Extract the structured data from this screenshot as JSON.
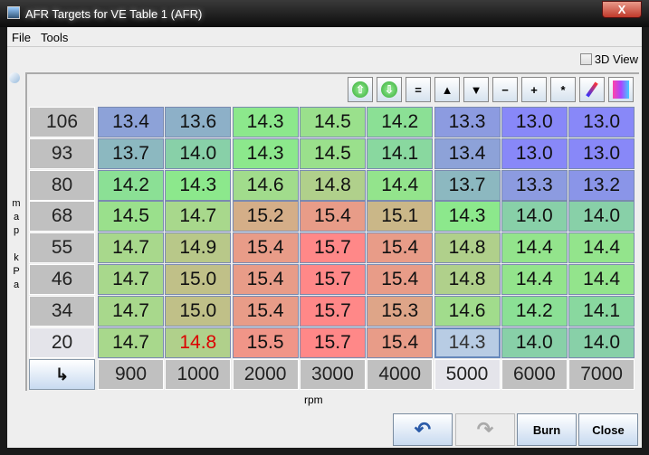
{
  "window": {
    "title": "AFR Targets for VE Table 1 (AFR)",
    "close": "X"
  },
  "menu": {
    "file": "File",
    "tools": "Tools"
  },
  "view3d": {
    "label": "3D View",
    "checked": false
  },
  "toolbar": [
    "arrow-up-circle",
    "arrow-down-circle",
    "=",
    "▲",
    "▼",
    "−",
    "+",
    "*",
    "pen",
    "gradient"
  ],
  "table": {
    "y_label": "map kPa",
    "x_label": "rpm",
    "y_axis": [
      "106",
      "93",
      "80",
      "68",
      "55",
      "46",
      "34",
      "20"
    ],
    "x_axis": [
      "900",
      "1000",
      "2000",
      "3000",
      "4000",
      "5000",
      "6000",
      "7000"
    ],
    "corner_icon": "↳",
    "values": [
      [
        "13.4",
        "13.6",
        "14.3",
        "14.5",
        "14.2",
        "13.3",
        "13.0",
        "13.0"
      ],
      [
        "13.7",
        "14.0",
        "14.3",
        "14.5",
        "14.1",
        "13.4",
        "13.0",
        "13.0"
      ],
      [
        "14.2",
        "14.3",
        "14.6",
        "14.8",
        "14.4",
        "13.7",
        "13.3",
        "13.2"
      ],
      [
        "14.5",
        "14.7",
        "15.2",
        "15.4",
        "15.1",
        "14.3",
        "14.0",
        "14.0"
      ],
      [
        "14.7",
        "14.9",
        "15.4",
        "15.7",
        "15.4",
        "14.8",
        "14.4",
        "14.4"
      ],
      [
        "14.7",
        "15.0",
        "15.4",
        "15.7",
        "15.4",
        "14.8",
        "14.4",
        "14.4"
      ],
      [
        "14.7",
        "15.0",
        "15.4",
        "15.7",
        "15.3",
        "14.6",
        "14.2",
        "14.1"
      ],
      [
        "14.7",
        "14.8",
        "15.5",
        "15.7",
        "15.4",
        "14.3",
        "14.0",
        "14.0"
      ]
    ],
    "selected_cell": {
      "row": 7,
      "col": 5
    },
    "highlight_cell": {
      "row": 7,
      "col": 1,
      "color": "#dd0000"
    }
  },
  "buttons": {
    "undo": "undo",
    "redo": "redo",
    "burn": "Burn",
    "close": "Close"
  }
}
